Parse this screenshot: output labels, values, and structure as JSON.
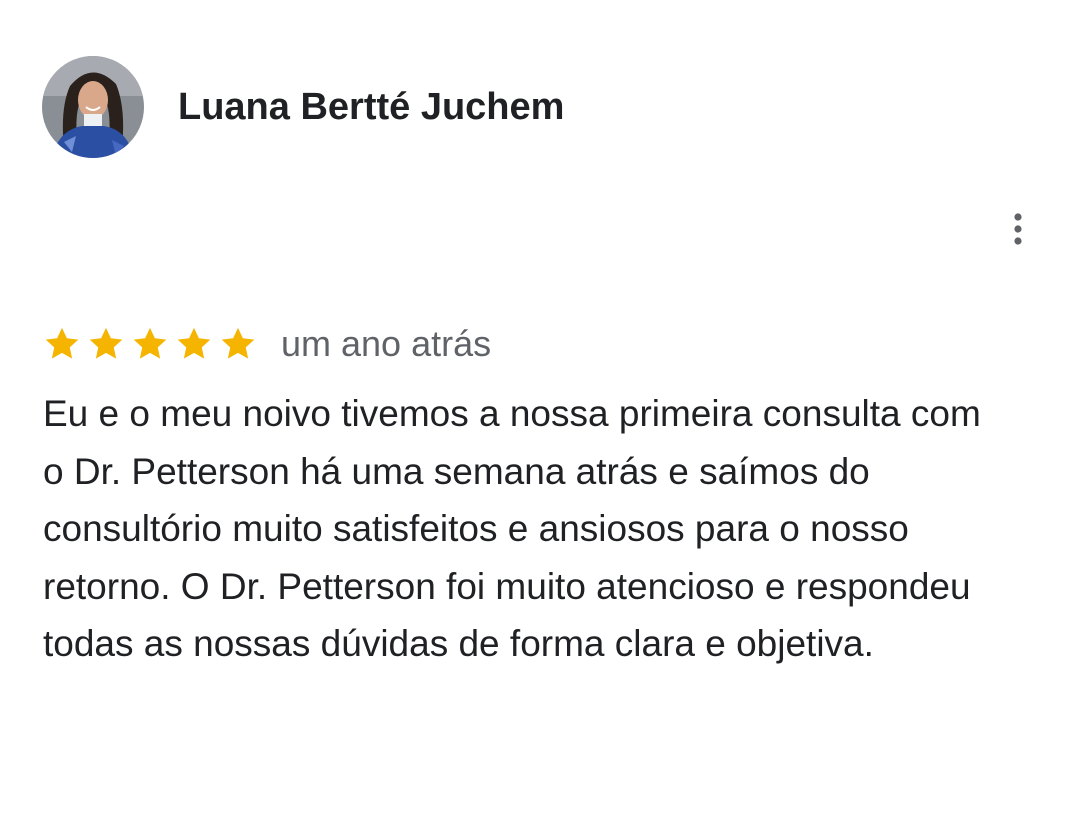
{
  "review": {
    "reviewer_name": "Luana Bertté Juchem",
    "avatar_icon": "reviewer-profile-photo",
    "more_icon": "more-vert-icon",
    "rating": 5,
    "rating_max": 5,
    "star_icon": "star-icon",
    "star_color": "#F4B400",
    "date": "um ano atrás",
    "text": "Eu e o meu noivo tivemos a nossa primeira consulta com o Dr. Petterson há uma semana atrás e saímos do consultório muito satisfeitos e ansiosos para o nosso retorno. O Dr. Petterson foi muito atencioso e respondeu todas as nossas dúvidas de forma clara e objetiva."
  }
}
